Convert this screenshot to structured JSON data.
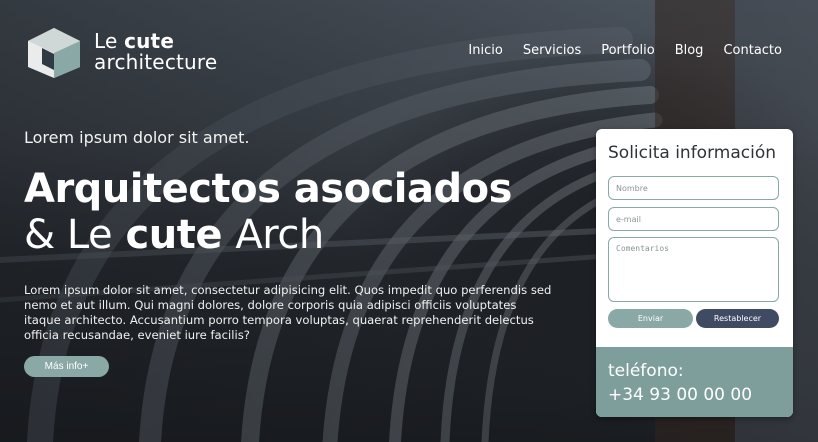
{
  "header": {
    "logo": {
      "line1_prefix": "Le",
      "line1_bold": "cute",
      "line2": "architecture"
    },
    "nav": [
      "Inicio",
      "Servicios",
      "Portfolio",
      "Blog",
      "Contacto"
    ]
  },
  "hero": {
    "lead": "Lorem ipsum dolor sit amet.",
    "title_line1": "Arquitectos asociados",
    "title_line2_prefix": "& Le",
    "title_line2_bold": "cute",
    "title_line2_suffix": "Arch",
    "description": "Lorem ipsum dolor sit amet, consectetur adipisicing elit. Quos impedit quo perferendis sed nemo et aut illum. Qui magni dolores, dolore corporis quia adipisci officiis voluptates itaque architecto. Accusantium porro tempora voluptas, quaerat reprehenderit delectus officia recusandae, eveniet iure facilis?",
    "more_button": "Más info+"
  },
  "form": {
    "title": "Solicita información",
    "name_placeholder": "Nombre",
    "email_placeholder": "e-mail",
    "comments_placeholder": "Comentarios",
    "send_button": "Enviar",
    "reset_button": "Restablecer",
    "phone_label": "teléfono:",
    "phone_number": "+34 93 00 00 00"
  },
  "colors": {
    "accent": "#8aa8a5",
    "dark_button": "#3f4a63",
    "phone_panel": "#7d9e9b"
  }
}
